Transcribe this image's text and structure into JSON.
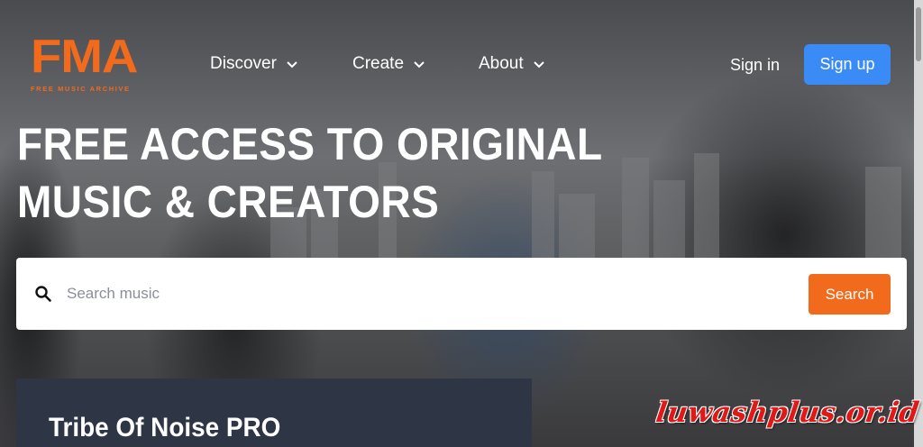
{
  "brand": {
    "logo_text": "FMA",
    "logo_subtitle": "FREE MUSIC ARCHIVE",
    "accent_color": "#f26a1b",
    "primary_color": "#3b8bf6"
  },
  "nav": {
    "items": [
      {
        "label": "Discover",
        "icon": "chevron-down-icon"
      },
      {
        "label": "Create",
        "icon": "chevron-down-icon"
      },
      {
        "label": "About",
        "icon": "chevron-down-icon"
      }
    ],
    "sign_in": "Sign in",
    "sign_up": "Sign up"
  },
  "hero": {
    "title": "FREE ACCESS TO ORIGINAL MUSIC & CREATORS"
  },
  "search": {
    "icon": "search-icon",
    "placeholder": "Search music",
    "button_label": "Search"
  },
  "card": {
    "title": "Tribe Of Noise PRO",
    "background_color": "#2e3545"
  },
  "watermark": {
    "text": "luwashplus.or.id"
  }
}
